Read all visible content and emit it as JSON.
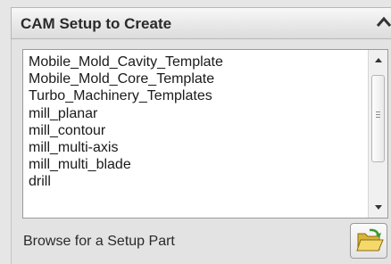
{
  "header": {
    "title": "CAM Setup to Create",
    "collapse_icon": "chevron-up-icon"
  },
  "setup_list": {
    "items": [
      "Mobile_Mold_Cavity_Template",
      "Mobile_Mold_Core_Template",
      "Turbo_Machinery_Templates",
      "mill_planar",
      "mill_contour",
      "mill_multi-axis",
      "mill_multi_blade",
      "drill"
    ]
  },
  "browse": {
    "label": "Browse for a Setup Part",
    "icon": "open-folder-icon"
  }
}
